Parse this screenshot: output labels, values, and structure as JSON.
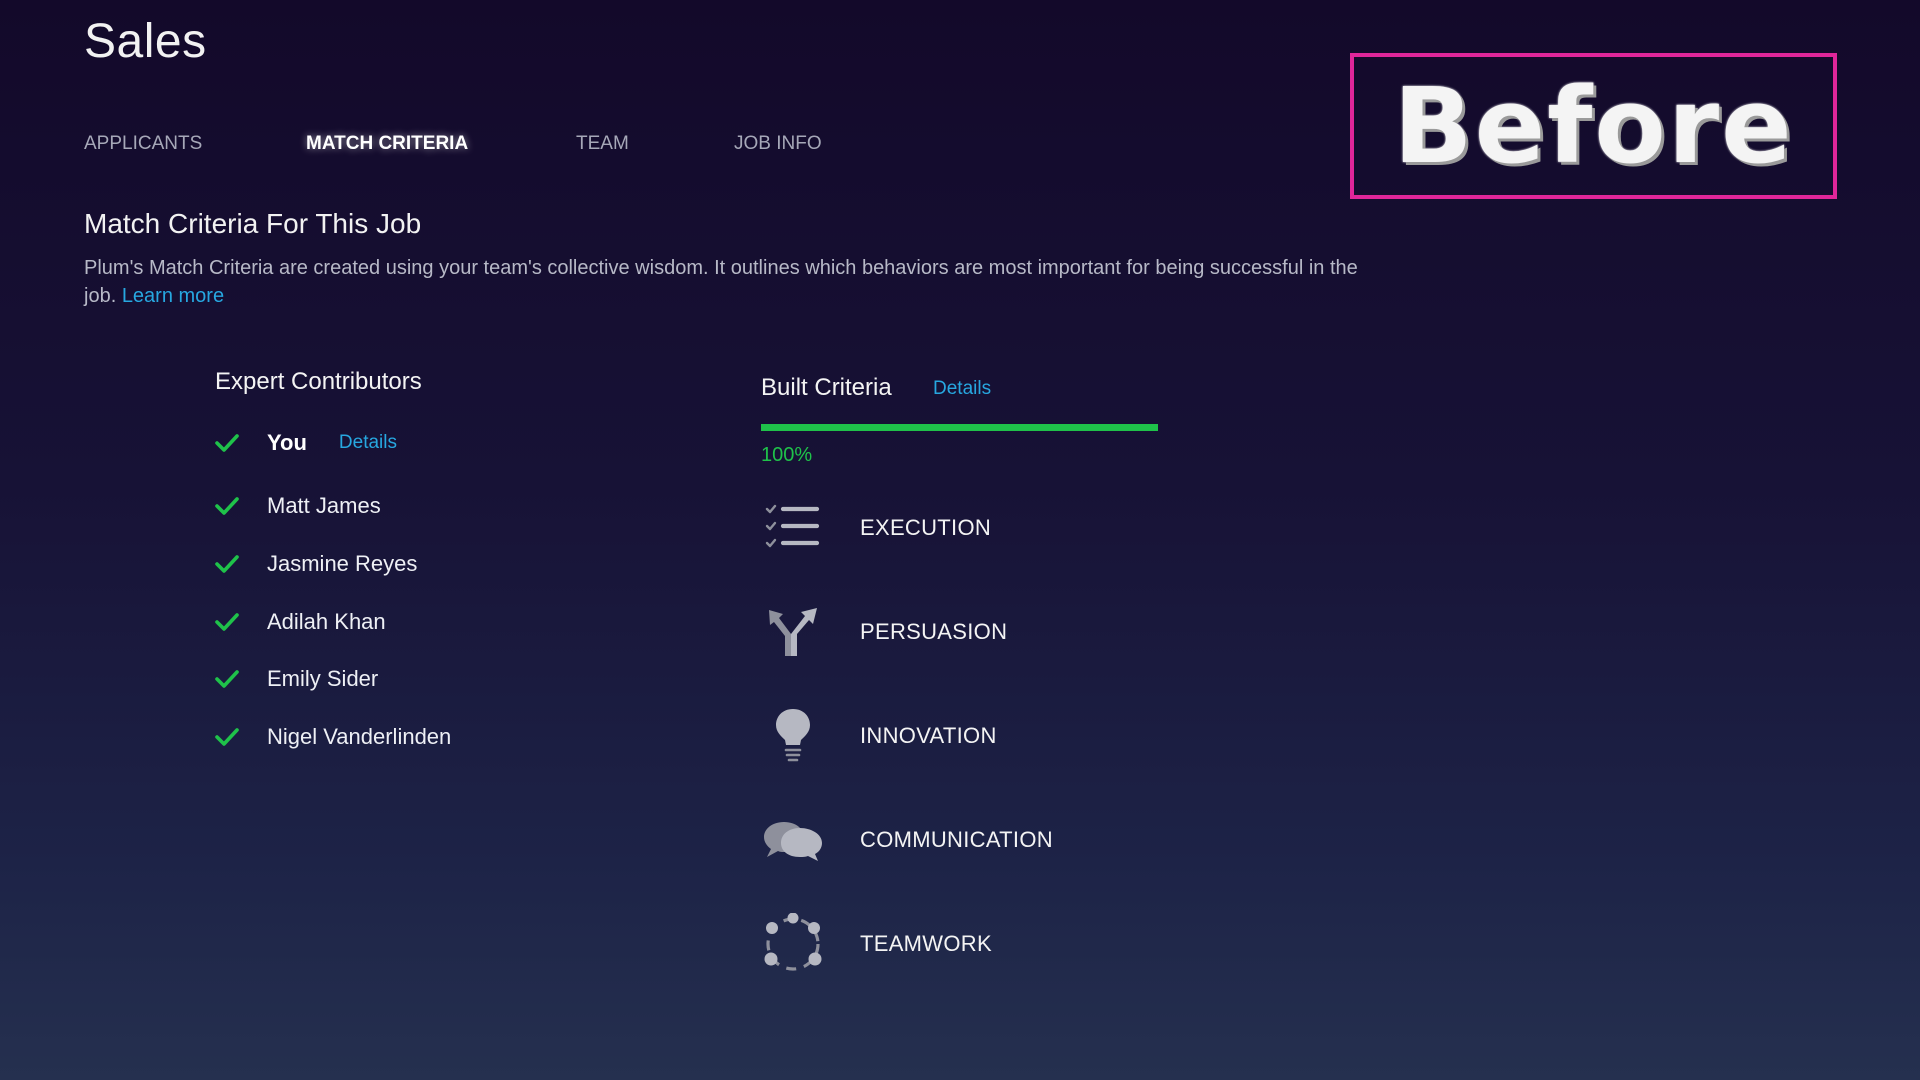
{
  "page": {
    "title": "Sales"
  },
  "tabs": [
    {
      "label": "APPLICANTS",
      "active": false
    },
    {
      "label": "MATCH CRITERIA",
      "active": true
    },
    {
      "label": "TEAM",
      "active": false
    },
    {
      "label": "JOB INFO",
      "active": false
    }
  ],
  "overlay": {
    "label": "Before",
    "border_color": "#e0269a"
  },
  "section": {
    "title": "Match Criteria For This Job",
    "description": "Plum's Match Criteria are created using your team's collective wisdom. It outlines which behaviors are most important for being successful in the job.",
    "learn_more": "Learn more"
  },
  "contributors": {
    "title": "Expert Contributors",
    "details_label": "Details",
    "items": [
      {
        "name": "You",
        "complete": true
      },
      {
        "name": "Matt James",
        "complete": true
      },
      {
        "name": "Jasmine Reyes",
        "complete": true
      },
      {
        "name": "Adilah Khan",
        "complete": true
      },
      {
        "name": "Emily Sider",
        "complete": true
      },
      {
        "name": "Nigel Vanderlinden",
        "complete": true
      }
    ]
  },
  "built_criteria": {
    "title": "Built Criteria",
    "details_label": "Details",
    "progress_value": 1.0,
    "progress_label": "100%",
    "items": [
      {
        "label": "EXECUTION",
        "icon": "checklist-icon"
      },
      {
        "label": "PERSUASION",
        "icon": "persuasion-arrows-icon"
      },
      {
        "label": "INNOVATION",
        "icon": "lightbulb-icon"
      },
      {
        "label": "COMMUNICATION",
        "icon": "speech-bubbles-icon"
      },
      {
        "label": "TEAMWORK",
        "icon": "team-circle-icon"
      }
    ]
  },
  "colors": {
    "accent_green": "#1fc24a",
    "link_blue": "#27a7e0",
    "icon_gray": "#8e909c"
  }
}
